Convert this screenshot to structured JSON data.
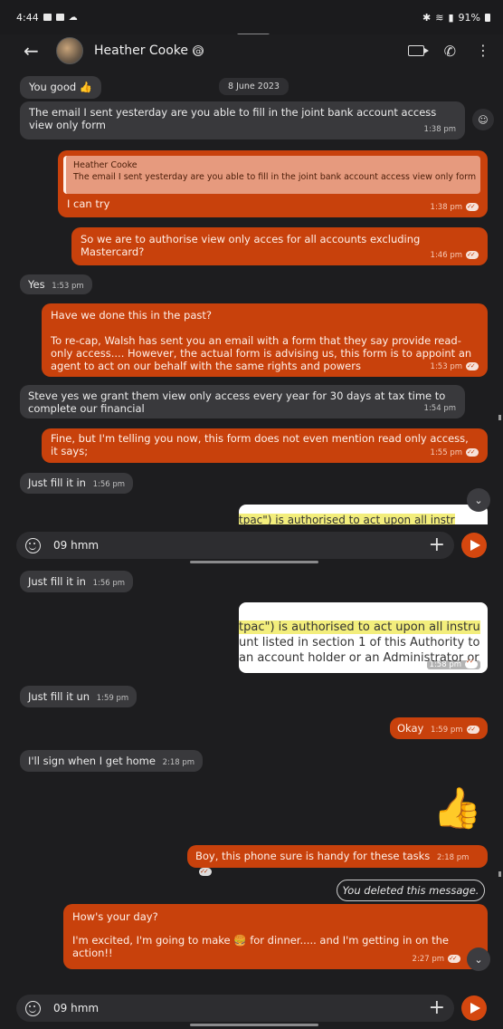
{
  "status": {
    "time": "4:44",
    "battery": "91%"
  },
  "header": {
    "contact_name": "Heather Cooke"
  },
  "date_chip": "8 June 2023",
  "messages": {
    "m1": {
      "text": "You good 👍"
    },
    "m2": {
      "text": "The email I sent yesterday are you able to fill in the joint bank account access view only form",
      "time": "1:38 pm"
    },
    "m3": {
      "quote_author": "Heather Cooke",
      "quote_text": "The email I sent yesterday are you able to fill in the joint bank account access view only form",
      "text": "I can try",
      "time": "1:38 pm"
    },
    "m4": {
      "text": "So we are to authorise view only acces for all accounts excluding Mastercard?",
      "time": "1:46 pm"
    },
    "m5": {
      "text": "Yes",
      "time": "1:53 pm"
    },
    "m6": {
      "line1": "Have we done this in the past?",
      "line2": "To re-cap, Walsh has sent you an email with a form that they say provide read-only access.... However, the actual form is advising us, this form is to appoint an agent to act on our behalf with the same rights and powers",
      "time": "1:53 pm"
    },
    "m7": {
      "text": "Steve yes we grant them view only access every year for 30 days at tax time to complete our financial",
      "time": "1:54 pm"
    },
    "m8": {
      "text": "Fine, but I'm telling you now, this form does not even mention read only access, it says;",
      "time": "1:55 pm"
    },
    "m9": {
      "text": "Just fill it in",
      "time": "1:56 pm"
    },
    "m9b": {
      "text": "Just fill it in",
      "time": "1:56 pm"
    },
    "img_msg": {
      "line1": "tpac\") is authorised to act upon all instru",
      "line2": "unt listed in section 1 of this Authority to",
      "line3": "an account holder or an Administrator or",
      "time": "1:58 pm"
    },
    "preview_snippet": "tpac\") is authorised to act upon all instr",
    "m10": {
      "text": "Just fill it un",
      "time": "1:59 pm"
    },
    "m11": {
      "text": "Okay",
      "time": "1:59 pm"
    },
    "m12": {
      "text": "I'll sign when I get home",
      "time": "2:18 pm"
    },
    "m13": {
      "text": "👍"
    },
    "m14": {
      "text": "Boy, this phone sure is handy for these tasks",
      "time": "2:18 pm"
    },
    "deleted": "You deleted this message.",
    "m15": {
      "line1": "How's your day?",
      "line2": "I'm excited, I'm going to make 🍔 for dinner..... and I'm getting in on the action!!",
      "time": "2:27 pm"
    }
  },
  "composer": {
    "text": "09 hmm"
  }
}
